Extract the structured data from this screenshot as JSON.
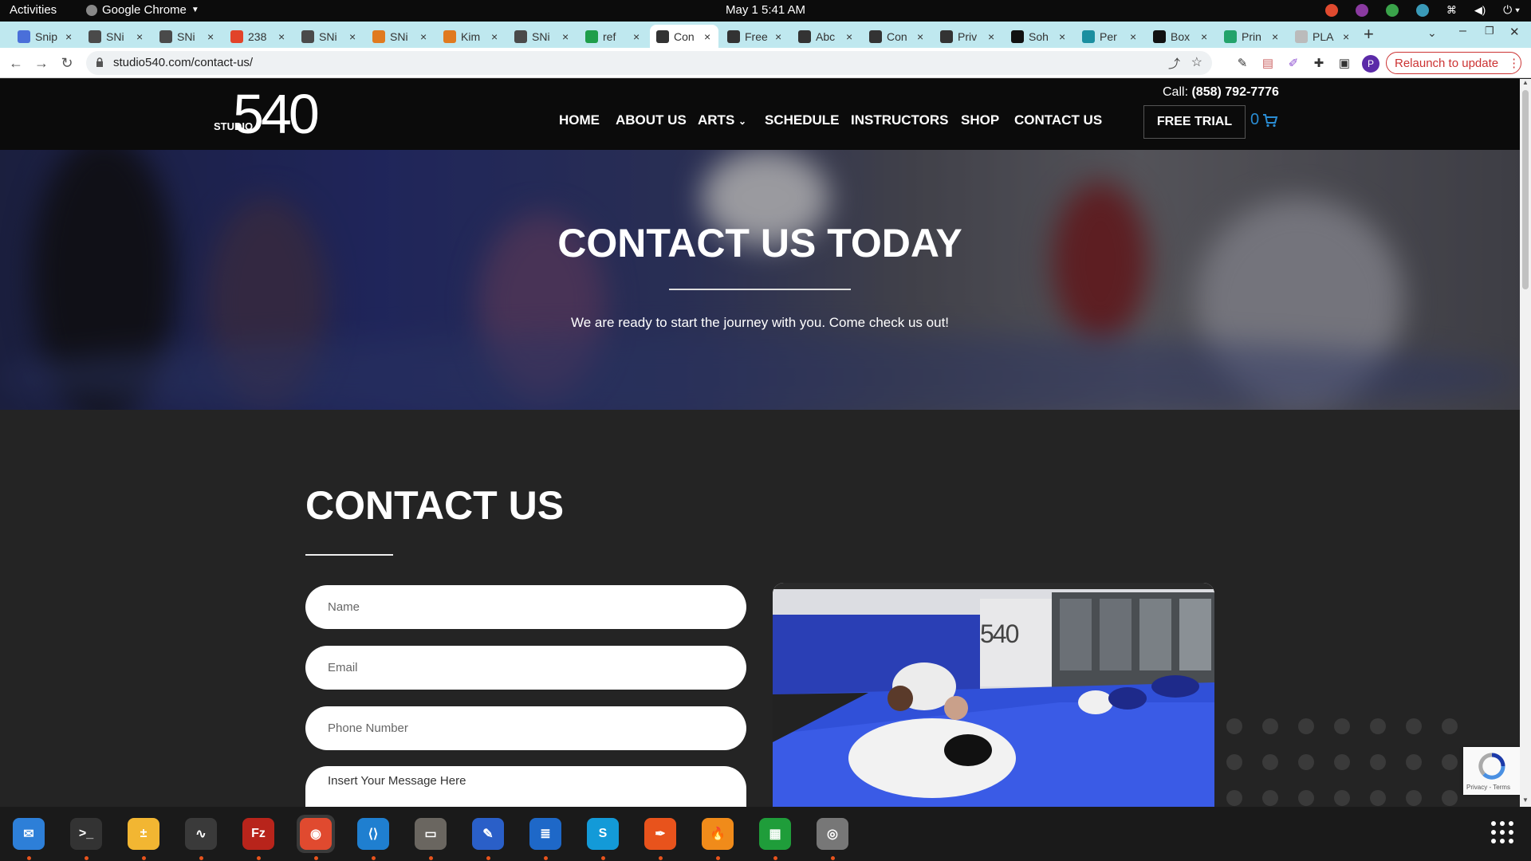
{
  "system": {
    "activities": "Activities",
    "app_name": "Google Chrome",
    "clock": "May 1  5:41 AM"
  },
  "tabs": [
    {
      "label": "Snip",
      "favicon_color": "#4a6fd9",
      "active": false
    },
    {
      "label": "SNi",
      "favicon_color": "#4a4a4a",
      "active": false
    },
    {
      "label": "SNi",
      "favicon_color": "#4a4a4a",
      "active": false
    },
    {
      "label": "238",
      "favicon_color": "#e24329",
      "active": false
    },
    {
      "label": "SNi",
      "favicon_color": "#4a4a4a",
      "active": false
    },
    {
      "label": "SNi",
      "favicon_color": "#e07a1f",
      "active": false
    },
    {
      "label": "Kim",
      "favicon_color": "#e07a1f",
      "active": false
    },
    {
      "label": "SNi",
      "favicon_color": "#4a4a4a",
      "active": false
    },
    {
      "label": "ref",
      "favicon_color": "#1e9e4a",
      "active": false
    },
    {
      "label": "Con",
      "favicon_color": "#333333",
      "active": true
    },
    {
      "label": "Free",
      "favicon_color": "#333333",
      "active": false
    },
    {
      "label": "Abc",
      "favicon_color": "#333333",
      "active": false
    },
    {
      "label": "Con",
      "favicon_color": "#333333",
      "active": false
    },
    {
      "label": "Priv",
      "favicon_color": "#333333",
      "active": false
    },
    {
      "label": "Soh",
      "favicon_color": "#111111",
      "active": false
    },
    {
      "label": "Per",
      "favicon_color": "#1a8fa0",
      "active": false
    },
    {
      "label": "Box",
      "favicon_color": "#111111",
      "active": false
    },
    {
      "label": "Prin",
      "favicon_color": "#23a36b",
      "active": false
    },
    {
      "label": "PLA",
      "favicon_color": "#bbbbbb",
      "active": false
    }
  ],
  "toolbar": {
    "url": "studio540.com/contact-us/",
    "relaunch": "Relaunch to update",
    "profile_initial": "P"
  },
  "site": {
    "logo_number": "540",
    "logo_word": "STUDIO",
    "nav": [
      "HOME",
      "ABOUT US",
      "ARTS",
      "SCHEDULE",
      "INSTRUCTORS",
      "SHOP",
      "CONTACT US"
    ],
    "call_label": "Call:",
    "call_number": "(858) 792-7776",
    "free_trial": "FREE TRIAL",
    "cart_count": "0",
    "hero_title": "CONTACT US TODAY",
    "hero_subtitle": "We are ready to start the journey with you. Come check us out!",
    "contact_title": "CONTACT US",
    "form": {
      "name_placeholder": "Name",
      "email_placeholder": "Email",
      "phone_placeholder": "Phone Number",
      "message_placeholder": "Insert Your Message Here"
    },
    "photo_wall_text": "540",
    "recaptcha_text": "Privacy - Terms"
  },
  "dock": [
    "thunderbird",
    "terminal",
    "calculator",
    "system-monitor",
    "filezilla",
    "chrome",
    "vscode",
    "files",
    "text-editor",
    "document-viewer",
    "skype",
    "inkscape",
    "app-flame",
    "spreadsheet",
    "disk-utility"
  ]
}
